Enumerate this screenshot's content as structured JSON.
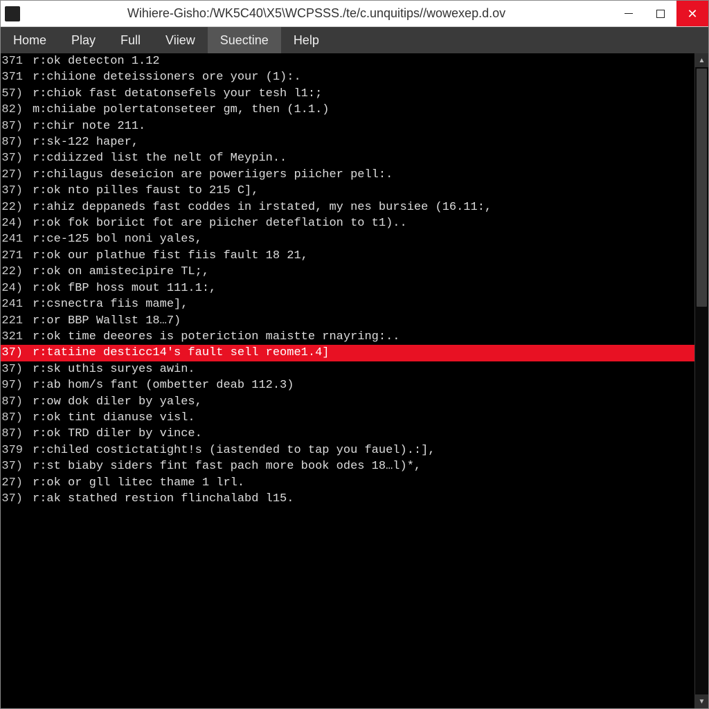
{
  "window": {
    "title": "Wihiere-Gisho:/WK5C40\\X5\\WCPSSS./te/c.unquitips//wowexep.d.ov"
  },
  "menu": {
    "items": [
      "Home",
      "Play",
      "Full",
      "Viiew",
      "Suectine",
      "Help"
    ],
    "active_index": 4
  },
  "editor": {
    "highlight_index": 18,
    "lines": [
      {
        "num": "371",
        "text": "r:ok detecton 1.12"
      },
      {
        "num": "371",
        "text": "r:chiione deteissioners ore your (1):."
      },
      {
        "num": "57)",
        "text": "r:chiok fast detatonsefels your tesh l1:;"
      },
      {
        "num": "82)",
        "text": "m:chiiabe polertatonseteer gm, then (1.1.)"
      },
      {
        "num": "87)",
        "text": "r:chir note 211."
      },
      {
        "num": "87)",
        "text": "r:sk-122 haper,"
      },
      {
        "num": "37)",
        "text": "r:cdiizzed list the nelt of Meypin.."
      },
      {
        "num": "27)",
        "text": "r:chilagus deseicion are poweriigers piicher pell:."
      },
      {
        "num": "37)",
        "text": "r:ok nto pilles faust to 215 C],"
      },
      {
        "num": "22)",
        "text": "r:ahiz deppaneds fast coddes in irstated, my nes bursiee (16.11:,"
      },
      {
        "num": "24)",
        "text": "r:ok fok boriict fot are piicher deteflation to t1).."
      },
      {
        "num": "241",
        "text": "r:ce-125 bol noni yales,"
      },
      {
        "num": "271",
        "text": "r:ok our plathue fist fiis fault 18 21,"
      },
      {
        "num": "22)",
        "text": "r:ok on amistecipire TL;,"
      },
      {
        "num": "24)",
        "text": "r:ok fBP hoss mout 111.1:,"
      },
      {
        "num": "241",
        "text": "r:csnectra fiis mame],"
      },
      {
        "num": "221",
        "text": "r:or BBP Wallst 18…7)"
      },
      {
        "num": "321",
        "text": "r:ok time deeores is poteriction maistte rnayring:.."
      },
      {
        "num": "37)",
        "text": "r:tatiine desticc14's fault sell reome1.4]"
      },
      {
        "num": "37)",
        "text": "r:sk uthis suryes awin."
      },
      {
        "num": "97)",
        "text": "r:ab hom/s fant (ombetter deab 112.3)"
      },
      {
        "num": "87)",
        "text": "r:ow dok diler by yales,"
      },
      {
        "num": "87)",
        "text": "r:ok tint dianuse visl."
      },
      {
        "num": "87)",
        "text": "r:ok TRD diler by vince."
      },
      {
        "num": "379",
        "text": "r:chiled costictatight!s (iastended to tap you fauel).:],"
      },
      {
        "num": "37)",
        "text": "r:st biaby siders fint fast pach more book odes 18…l)*,"
      },
      {
        "num": "27)",
        "text": "r:ok or gll litec thame 1 lrl."
      },
      {
        "num": "37)",
        "text": "r:ak stathed restion flinchalabd l15."
      }
    ]
  }
}
